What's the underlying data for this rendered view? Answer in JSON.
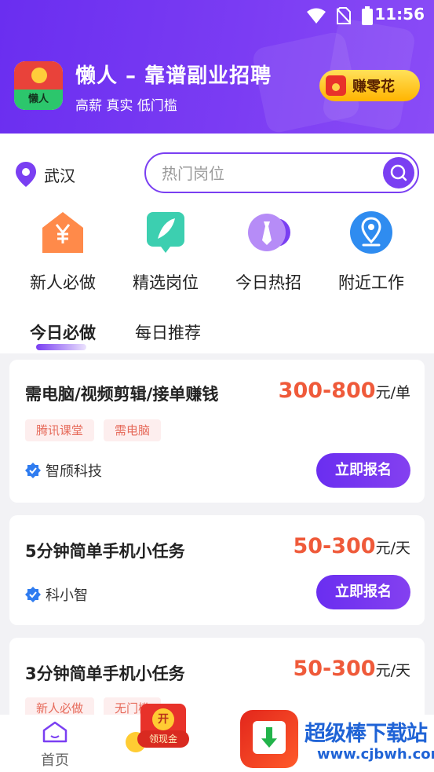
{
  "status_bar": {
    "time": "11:56",
    "icons": [
      "wifi-icon",
      "no-sim-icon",
      "battery-icon"
    ]
  },
  "header": {
    "logo_label": "懒人",
    "title": "懒人 – 靠谱副业招聘",
    "subtitle": "高薪 真实 低门槛",
    "earn_button": "赚零花"
  },
  "location": {
    "city": "武汉"
  },
  "search": {
    "placeholder": "热门岗位"
  },
  "categories": [
    {
      "label": "新人必做",
      "icon": "yuan-house-icon"
    },
    {
      "label": "精选岗位",
      "icon": "feather-book-icon"
    },
    {
      "label": "今日热招",
      "icon": "tie-icon"
    },
    {
      "label": "附近工作",
      "icon": "location-pin-icon"
    }
  ],
  "tabs": [
    {
      "label": "今日必做",
      "active": true
    },
    {
      "label": "每日推荐",
      "active": false
    }
  ],
  "jobs": [
    {
      "title": "需电脑/视频剪辑/接单赚钱",
      "price": "300-800",
      "unit": "元/单",
      "tags": [
        "腾讯课堂",
        "需电脑"
      ],
      "company": "智颀科技",
      "apply": "立即报名"
    },
    {
      "title": "5分钟简单手机小任务",
      "price": "50-300",
      "unit": "元/天",
      "tags": [],
      "company": "科小智",
      "apply": "立即报名"
    },
    {
      "title": "3分钟简单手机小任务",
      "price": "50-300",
      "unit": "元/天",
      "tags": [
        "新人必做",
        "无门槛"
      ],
      "company": "",
      "apply": ""
    }
  ],
  "nav": {
    "home": "首页",
    "cash_open": "开",
    "cash_label": "领现金"
  },
  "watermark": {
    "text": "超级棒下载站",
    "url": "www.cjbwh.com"
  },
  "colors": {
    "primary": "#7a3ff2",
    "price": "#ef5a3a",
    "tag_bg": "#fdeeee",
    "tag_text": "#e66a5a"
  }
}
